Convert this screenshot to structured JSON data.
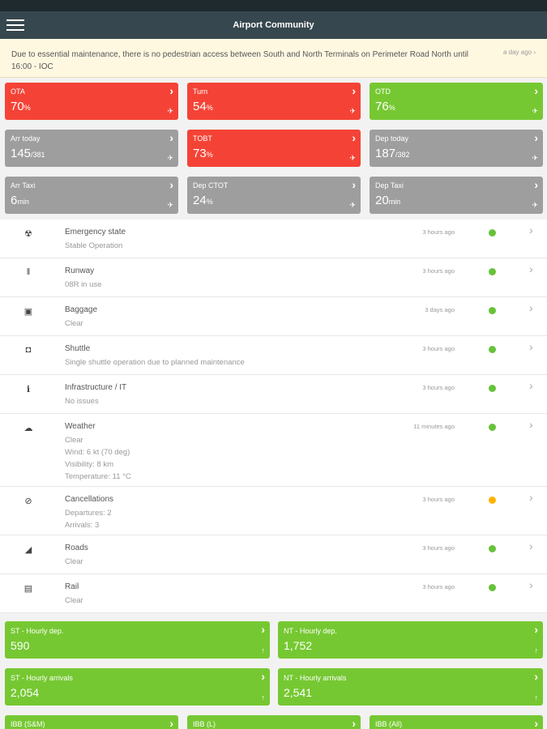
{
  "app": {
    "title": "Airport Community"
  },
  "notice": {
    "text": "Due to essential maintenance, there is no pedestrian access between South and North Terminals on Perimeter Road North until 16:00 - IOC",
    "time": "a day ago"
  },
  "tiles_row1": [
    {
      "label": "OTA",
      "value": "70",
      "unit": "%",
      "color": "red"
    },
    {
      "label": "Turn",
      "value": "54",
      "unit": "%",
      "color": "red"
    },
    {
      "label": "OTD",
      "value": "76",
      "unit": "%",
      "color": "green"
    }
  ],
  "tiles_row2": [
    {
      "label": "Arr today",
      "value": "145",
      "unit": "/381",
      "color": "gray"
    },
    {
      "label": "TOBT",
      "value": "73",
      "unit": "%",
      "color": "red"
    },
    {
      "label": "Dep today",
      "value": "187",
      "unit": "/382",
      "color": "gray"
    }
  ],
  "tiles_row3": [
    {
      "label": "Arr Taxi",
      "value": "6",
      "unit": "min",
      "color": "gray"
    },
    {
      "label": "Dep CTOT",
      "value": "24",
      "unit": "%",
      "color": "gray"
    },
    {
      "label": "Dep Taxi",
      "value": "20",
      "unit": "min",
      "color": "gray"
    }
  ],
  "status_list": [
    {
      "icon": "alarm-icon",
      "title": "Emergency state",
      "lines": [
        "Stable Operation"
      ],
      "time": "3 hours ago",
      "status": "green"
    },
    {
      "icon": "runway-icon",
      "title": "Runway",
      "lines": [
        "08R in use"
      ],
      "time": "3 hours ago",
      "status": "green"
    },
    {
      "icon": "briefcase-icon",
      "title": "Baggage",
      "lines": [
        "Clear"
      ],
      "time": "3 days ago",
      "status": "green"
    },
    {
      "icon": "shuttle-icon",
      "title": "Shuttle",
      "lines": [
        "Single shuttle operation due to planned maintenance"
      ],
      "time": "3 hours ago",
      "status": "green"
    },
    {
      "icon": "info-icon",
      "title": "Infrastructure / IT",
      "lines": [
        "No issues"
      ],
      "time": "3 hours ago",
      "status": "green"
    },
    {
      "icon": "weather-icon",
      "title": "Weather",
      "lines": [
        "Clear",
        "Wind: 6 kt (70 deg)",
        "Visibility: 8 km",
        "Temperature: 11 °C"
      ],
      "time": "11 minutes ago",
      "status": "green"
    },
    {
      "icon": "cancel-icon",
      "title": "Cancellations",
      "lines": [
        "Departures: 2",
        "Arrivals: 3"
      ],
      "time": "3 hours ago",
      "status": "amber"
    },
    {
      "icon": "car-icon",
      "title": "Roads",
      "lines": [
        "Clear"
      ],
      "time": "3 hours ago",
      "status": "green"
    },
    {
      "icon": "train-icon",
      "title": "Rail",
      "lines": [
        "Clear"
      ],
      "time": "3 hours ago",
      "status": "green"
    }
  ],
  "hourly_row1": [
    {
      "label": "ST - Hourly dep.",
      "value": "590"
    },
    {
      "label": "NT - Hourly dep.",
      "value": "1,752"
    }
  ],
  "hourly_row2": [
    {
      "label": "ST - Hourly arrivals",
      "value": "2,054"
    },
    {
      "label": "NT - Hourly arrivals",
      "value": "2,541"
    }
  ],
  "bottom_tiles": [
    {
      "label": "IBB (S&M)"
    },
    {
      "label": "IBB (L)"
    },
    {
      "label": "IBB (All)"
    }
  ],
  "colors": {
    "red": "#f44336",
    "gray": "#9e9e9e",
    "green": "#76c832",
    "amber": "#ffb300",
    "dot_green": "#67c23a"
  }
}
